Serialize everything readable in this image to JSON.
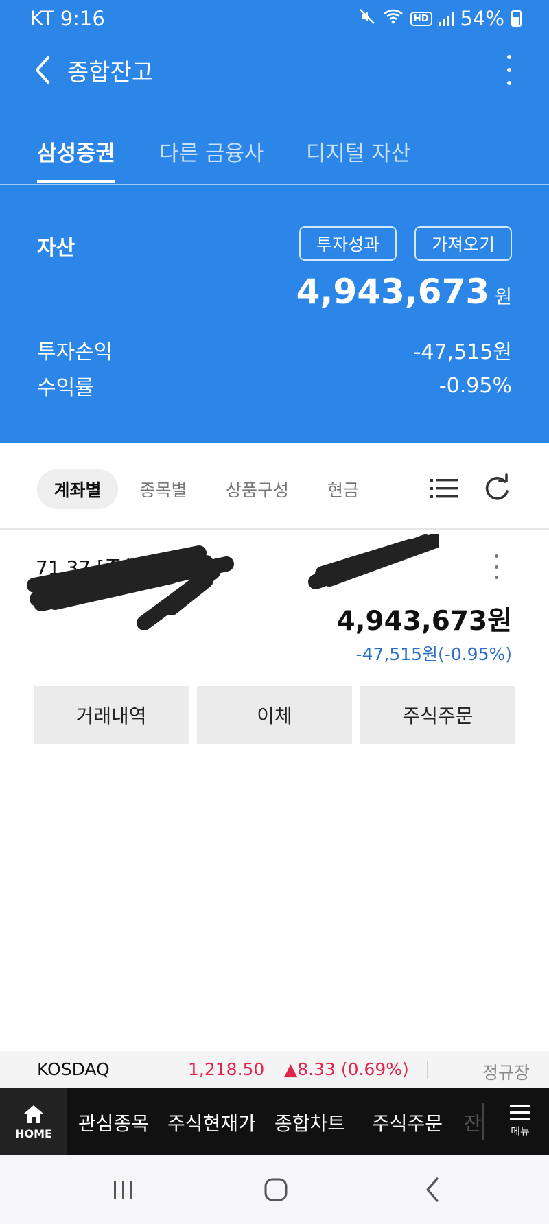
{
  "status_bar": {
    "carrier_time": "KT 9:16",
    "battery": "54%",
    "icons": [
      "mute-icon",
      "wifi-icon",
      "hd-icon",
      "signal-icon",
      "battery-icon"
    ],
    "hd_label": "HD"
  },
  "header": {
    "title": "종합잔고",
    "back_icon": "chevron-left-icon",
    "more_icon": "more-vertical-icon"
  },
  "top_tabs": [
    {
      "label": "삼성증권",
      "active": true
    },
    {
      "label": "다른 금융사",
      "active": false
    },
    {
      "label": "디지털 자산",
      "active": false
    }
  ],
  "asset_summary": {
    "label": "자산",
    "performance_button": "투자성과",
    "import_button": "가져오기",
    "amount": "4,943,673",
    "unit": "원",
    "pnl_label": "투자손익",
    "pnl_value": "-47,515원",
    "rate_label": "수익률",
    "rate_value": "-0.95%"
  },
  "sub_tabs": [
    {
      "label": "계좌별",
      "active": true
    },
    {
      "label": "종목별",
      "active": false
    },
    {
      "label": "상품구성",
      "active": false
    },
    {
      "label": "현금",
      "active": false
    }
  ],
  "sub_tab_icons": [
    "list-icon",
    "refresh-icon"
  ],
  "account": {
    "name_visible": "71 37 [종합(비대면)]",
    "amount": "4,943,673원",
    "change": "-47,515원(-0.95%)",
    "actions": [
      "거래내역",
      "이체",
      "주식주문"
    ]
  },
  "ticker": {
    "index_name": "KOSDAQ",
    "value": "1,218.50",
    "change": "▲8.33 (0.69%)",
    "session": "정규장"
  },
  "bottom_nav": {
    "home_label": "HOME",
    "items": [
      "관심종목",
      "주식현재가",
      "종합차트",
      "주식주문"
    ],
    "partial_item": "잔",
    "menu_label": "메뉴"
  },
  "system_nav": [
    "recent-apps-icon",
    "home-icon",
    "back-icon"
  ],
  "colors": {
    "header_blue": "#2b86e8",
    "up_red": "#e0264b",
    "change_blue": "#2a6fc9"
  }
}
